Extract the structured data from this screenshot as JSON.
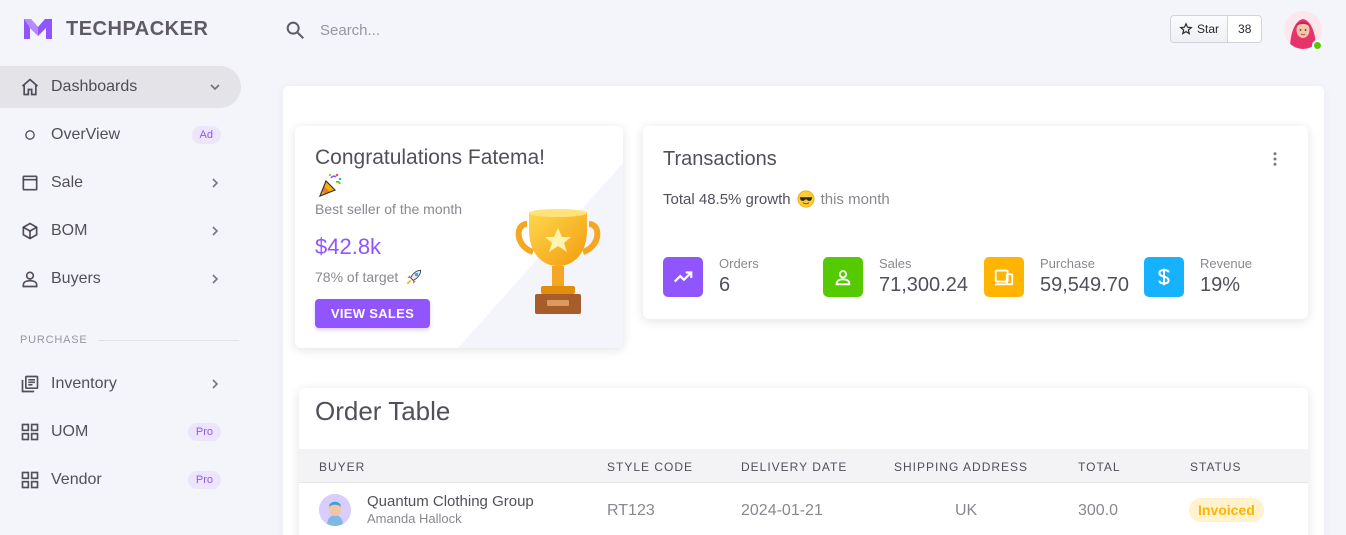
{
  "brand": {
    "name": "TECHPACKER",
    "color": "#9155fd"
  },
  "sidebar": {
    "items": [
      {
        "label": "Dashboards",
        "icon": "home-icon",
        "active": true,
        "trailing": "chevron-down"
      },
      {
        "label": "OverView",
        "icon": "circle-icon",
        "badge": "Ad"
      },
      {
        "label": "Sale",
        "icon": "square-icon",
        "trailing": "chevron-right"
      },
      {
        "label": "BOM",
        "icon": "cube-icon",
        "trailing": "chevron-right"
      },
      {
        "label": "Buyers",
        "icon": "user-icon",
        "trailing": "chevron-right"
      }
    ],
    "section": "PURCHASE",
    "purchase_items": [
      {
        "label": "Inventory",
        "icon": "inventory-icon",
        "trailing": "chevron-right"
      },
      {
        "label": "UOM",
        "icon": "grid-icon",
        "badge": "Pro"
      },
      {
        "label": "Vendor",
        "icon": "grid-icon",
        "badge": "Pro"
      }
    ]
  },
  "search": {
    "placeholder": "Search..."
  },
  "github": {
    "star_label": "Star",
    "count": "38"
  },
  "congrats": {
    "title": "Congratulations Fatema!",
    "subtitle": "Best seller of the month",
    "amount": "$42.8k",
    "target": "78% of target",
    "button": "VIEW SALES"
  },
  "transactions": {
    "title": "Transactions",
    "growth": "Total 48.5% growth",
    "period": "this month",
    "stats": [
      {
        "label": "Orders",
        "value": "6",
        "color": "#9155fd",
        "icon": "trending-up-icon"
      },
      {
        "label": "Sales",
        "value": "71,300.24",
        "color": "#56ca00",
        "icon": "account-icon"
      },
      {
        "label": "Purchase",
        "value": "59,549.70",
        "color": "#ffb400",
        "icon": "devices-icon"
      },
      {
        "label": "Revenue",
        "value": "19%",
        "color": "#16b1ff",
        "icon": "dollar-icon"
      }
    ]
  },
  "orders": {
    "title": "Order Table",
    "columns": [
      "BUYER",
      "STYLE CODE",
      "DELIVERY DATE",
      "SHIPPING ADDRESS",
      "TOTAL",
      "STATUS"
    ],
    "rows": [
      {
        "buyer": "Quantum Clothing Group",
        "contact": "Amanda Hallock",
        "style_code": "RT123",
        "delivery_date": "2024-01-21",
        "shipping_address": "UK",
        "total": "300.0",
        "status": "Invoiced"
      }
    ]
  }
}
